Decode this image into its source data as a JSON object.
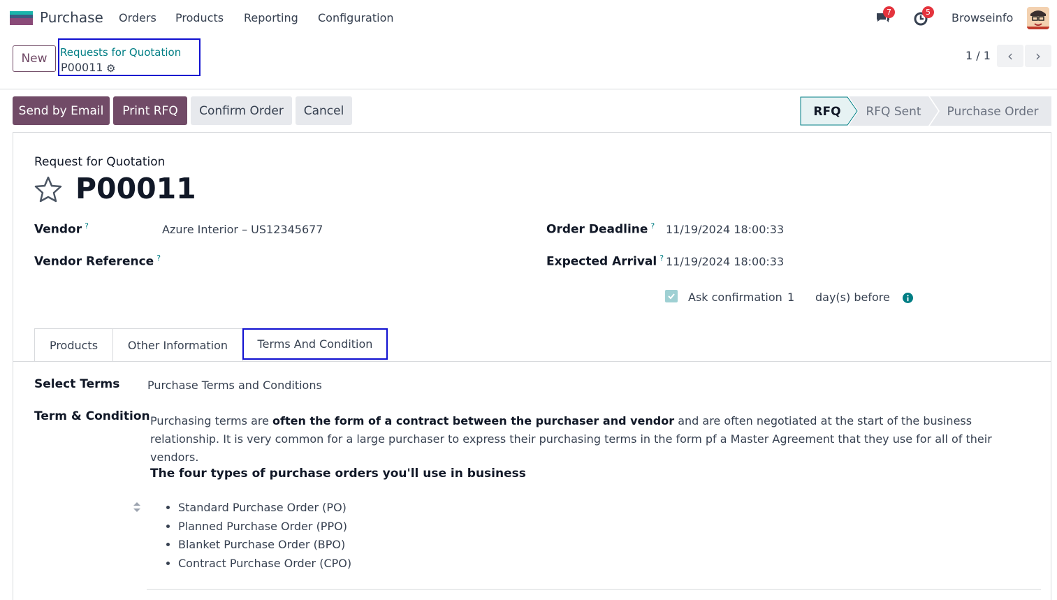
{
  "navbar": {
    "app_name": "Purchase",
    "menu": [
      "Orders",
      "Products",
      "Reporting",
      "Configuration"
    ],
    "messages_count": "7",
    "activities_count": "5",
    "company": "Browseinfo"
  },
  "control": {
    "new_label": "New",
    "breadcrumb_parent": "Requests for Quotation",
    "breadcrumb_current": "P00011",
    "pager": "1 / 1"
  },
  "actions": {
    "send_email": "Send by Email",
    "print_rfq": "Print RFQ",
    "confirm_order": "Confirm Order",
    "cancel": "Cancel"
  },
  "status_steps": [
    "RFQ",
    "RFQ Sent",
    "Purchase Order"
  ],
  "form": {
    "doc_type": "Request for Quotation",
    "name": "P00011",
    "vendor_label": "Vendor",
    "vendor_value": "Azure Interior – US12345677",
    "vendor_ref_label": "Vendor Reference",
    "order_deadline_label": "Order Deadline",
    "order_deadline_value": "11/19/2024 18:00:33",
    "expected_arrival_label": "Expected Arrival",
    "expected_arrival_value": "11/19/2024 18:00:33",
    "ask_confirmation_label": "Ask confirmation",
    "ask_confirmation_days": "1",
    "days_before": "day(s) before",
    "help_mark": "?"
  },
  "tabs": [
    "Products",
    "Other Information",
    "Terms And Condition"
  ],
  "terms": {
    "select_terms_label": "Select Terms",
    "select_terms_value": "Purchase Terms and Conditions",
    "term_condition_label": "Term & Condition",
    "para_start": "Purchasing terms are ",
    "para_bold": "often the form of a contract between the purchaser and vendor",
    "para_end": " and are often negotiated at the start of the business relationship. It is very common for a large purchaser to express their purchasing terms in the form pf a Master Agreement that they use for all of their vendors.",
    "heading": "The four types of purchase orders you'll use in business",
    "list": [
      "Standard Purchase Order (PO)",
      "Planned Purchase Order (PPO)",
      "Blanket Purchase Order (BPO)",
      "Contract Purchase Order (CPO)"
    ]
  },
  "colors": {
    "brand": "#714b67",
    "link": "#017e84",
    "highlight_border": "#1010d0",
    "badge": "#e4343d"
  }
}
